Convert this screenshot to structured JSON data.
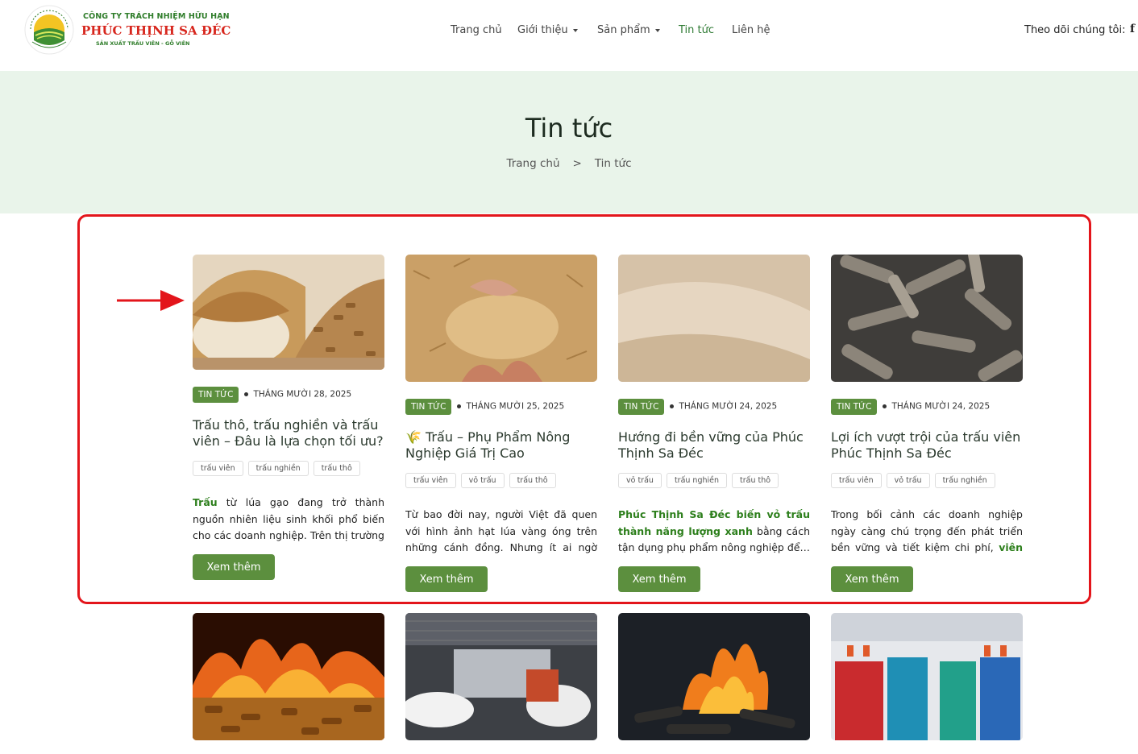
{
  "header": {
    "company_small": "CÔNG TY TRÁCH NHIỆM HỮU HẠN",
    "company_name": "PHÚC THỊNH SA ĐÉC",
    "company_tagline": "SẢN XUẤT TRẤU VIÊN - GỖ VIÊN",
    "logo_ring_text": "PHÚC THỊNH",
    "logo_bottom_text": "UY TÍN CHẤT LƯỢNG",
    "nav": [
      {
        "label": "Trang chủ"
      },
      {
        "label": "Giới thiệu"
      },
      {
        "label": "Sản phẩm"
      },
      {
        "label": "Tin tức"
      },
      {
        "label": "Liên hệ"
      }
    ],
    "follow_label": "Theo dõi chúng tôi:",
    "facebook_icon": "f"
  },
  "hero": {
    "title": "Tin tức",
    "breadcrumb": [
      "Trang chủ",
      ">",
      "Tin tức"
    ]
  },
  "colors": {
    "brand_green": "#5c8f3e",
    "brand_red": "#d7261d",
    "hero_bg": "#e9f4ea",
    "highlight": "#e3151b"
  },
  "posts": [
    {
      "badge": "TIN TỨC",
      "date": "THÁNG MƯỜI 28, 2025",
      "title": "Trấu thô, trấu nghiền và trấu viên – Đâu là lựa chọn tối ưu?",
      "tags": [
        "trấu viên",
        "trấu nghiền",
        "trấu thô"
      ],
      "excerpt_bold": "Trấu",
      "excerpt": " từ lúa gạo đang trở thành nguồn nhiên liệu sinh khối phổ biến cho các doanh nghiệp. Trên thị trường hi…",
      "button": "Xem thêm",
      "image": "rice-husk-pellets-bowl"
    },
    {
      "badge": "TIN TỨC",
      "date": "THÁNG MƯỜI 25, 2025",
      "title": "🌾 Trấu – Phụ Phẩm Nông Nghiệp Giá Trị Cao",
      "tags": [
        "trấu viên",
        "vỏ trấu",
        "trấu thô"
      ],
      "excerpt_bold": "",
      "excerpt": "Từ bao đời nay, người Việt đã quen với hình ảnh hạt lúa vàng óng trên những cánh đồng. Nhưng ít ai ngờ rằng, ",
      "excerpt_tail": "l…",
      "button": "Xem thêm",
      "image": "hands-holding-husk"
    },
    {
      "badge": "TIN TỨC",
      "date": "THÁNG MƯỜI 24, 2025",
      "title": "Hướng đi bền vững của Phúc Thịnh Sa Đéc",
      "tags": [
        "vỏ trấu",
        "trấu nghiền",
        "trấu thô"
      ],
      "excerpt_bold": "Phúc Thịnh Sa Đéc biến vỏ trấu thành năng lượng xanh",
      "excerpt": " bằng cách tận dụng phụ phẩm nông nghiệp để…",
      "button": "Xem thêm",
      "image": "ground-husk-powder"
    },
    {
      "badge": "TIN TỨC",
      "date": "THÁNG MƯỜI 24, 2025",
      "title": "Lợi ích vượt trội của trấu viên Phúc Thịnh Sa Đéc",
      "tags": [
        "trấu viên",
        "vỏ trấu",
        "trấu nghiền"
      ],
      "excerpt_bold": "",
      "excerpt": "Trong bối cảnh các doanh nghiệp ngày càng chú trọng đến phát triển bền vững và tiết kiệm chi phí, ",
      "excerpt_tail": "viên n…",
      "button": "Xem thêm",
      "image": "husk-pellets-closeup"
    }
  ],
  "more_images": [
    "burning-pellets",
    "paper-factory",
    "burning-charcoal",
    "textile-spools"
  ]
}
